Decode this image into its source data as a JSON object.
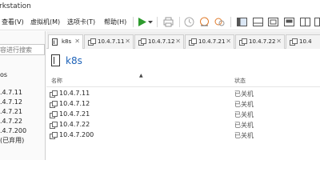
{
  "window": {
    "title": "rkstation"
  },
  "menu": {
    "items": [
      "查看(V)",
      "虚拟机(M)",
      "选项卡(T)",
      "帮助(H)"
    ]
  },
  "toolbar": {
    "icons": [
      "play-icon",
      "dropdown-arrow-icon",
      "print-icon",
      "clock-icon",
      "snapshot-revert-icon",
      "snapshot-manager-icon",
      "full-screen-icon",
      "layout-sidebar-icon",
      "layout-console-icon",
      "layout-thumbnail-icon",
      "layout-tabs-icon",
      "layout-grid-icon"
    ],
    "accent": "#2e9b2e"
  },
  "sidebar": {
    "search_placeholder": "容进行搜索",
    "items": [
      {
        "label": "os"
      },
      {
        "label": ".4.7.11"
      },
      {
        "label": ".4.7.12"
      },
      {
        "label": ".4.7.21"
      },
      {
        "label": ".4.7.22"
      },
      {
        "label": ".4.7.200"
      },
      {
        "label": "(已弃用)"
      }
    ]
  },
  "tabs": [
    {
      "label": "k8s",
      "active": true
    },
    {
      "label": "10.4.7.11",
      "active": false
    },
    {
      "label": "10.4.7.12",
      "active": false
    },
    {
      "label": "10.4.7.21",
      "active": false
    },
    {
      "label": "10.4.7.22",
      "active": false
    },
    {
      "label": "10.4",
      "active": false
    }
  ],
  "folder": {
    "title": "k8s",
    "columns": {
      "name": "名称",
      "status": "状态"
    },
    "rows": [
      {
        "name": "10.4.7.11",
        "status": "已关机"
      },
      {
        "name": "10.4.7.12",
        "status": "已关机"
      },
      {
        "name": "10.4.7.21",
        "status": "已关机"
      },
      {
        "name": "10.4.7.22",
        "status": "已关机"
      },
      {
        "name": "10.4.7.200",
        "status": "已关机"
      }
    ]
  }
}
